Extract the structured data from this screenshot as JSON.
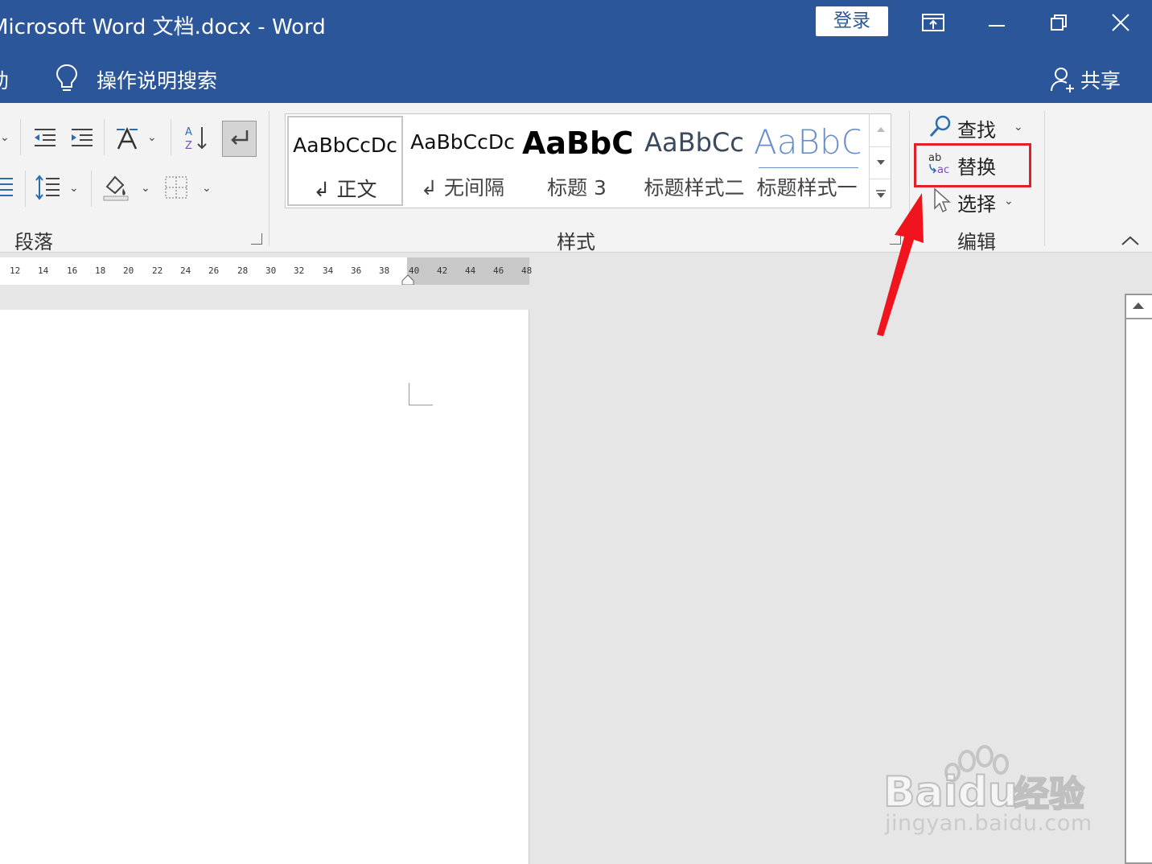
{
  "window": {
    "title": "Microsoft Word 文档.docx  -  Word",
    "login_label": "登录"
  },
  "tellbar": {
    "partial_tab": "助",
    "tellme_text": "操作说明搜索",
    "share_label": "共享"
  },
  "ribbon": {
    "groups": {
      "paragraph": "段落",
      "styles": "样式",
      "editing": "编辑"
    },
    "styles_gallery": [
      {
        "preview": "AaBbCcDc",
        "name": "↲ 正文",
        "selected": true
      },
      {
        "preview": "AaBbCcDc",
        "name": "↲ 无间隔",
        "selected": false
      },
      {
        "preview": "AaBbC",
        "name": "标题 3",
        "selected": false
      },
      {
        "preview": "AaBbCc",
        "name": "标题样式二",
        "selected": false
      },
      {
        "preview": "AaBbC",
        "name": "标题样式一",
        "selected": false
      }
    ],
    "editing": {
      "find_label": "查找",
      "replace_label": "替换",
      "select_label": "选择"
    }
  },
  "ruler": {
    "ticks": [
      "12",
      "14",
      "16",
      "18",
      "20",
      "22",
      "24",
      "26",
      "28",
      "30",
      "32",
      "34",
      "36",
      "38",
      "40",
      "42",
      "44",
      "46",
      "48"
    ]
  },
  "watermark": {
    "brand": "Baidu",
    "brand_cn": "经验",
    "url": "jingyan.baidu.com"
  },
  "colors": {
    "title_bar": "#2b579a",
    "ribbon": "#f3f3f3",
    "highlight": "#e2202a",
    "canvas": "#e6e6e6"
  }
}
